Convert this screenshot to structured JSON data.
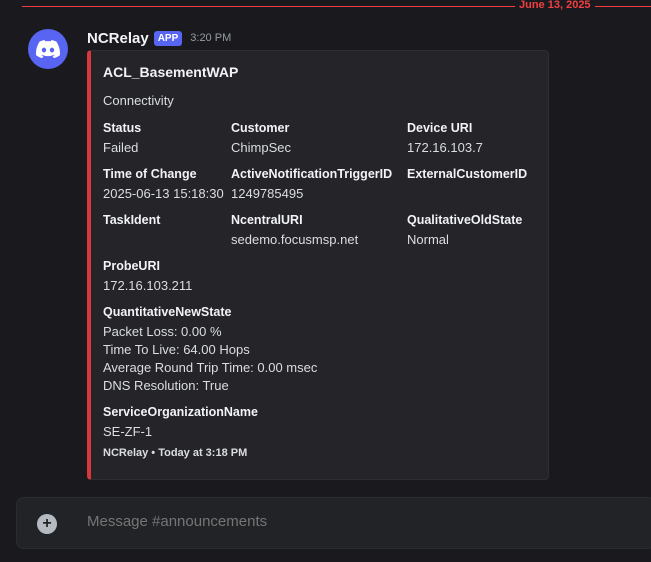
{
  "divider": {
    "date": "June 13, 2025"
  },
  "message": {
    "username": "NCRelay",
    "badge": "APP",
    "time": "3:20 PM"
  },
  "embed": {
    "title": "ACL_BasementWAP",
    "description": "Connectivity",
    "fields": {
      "status": {
        "name": "Status",
        "value": "Failed"
      },
      "customer": {
        "name": "Customer",
        "value": "ChimpSec"
      },
      "device_uri": {
        "name": "Device URI",
        "value": "172.16.103.7"
      },
      "time_of_change": {
        "name": "Time of Change",
        "value": "2025-06-13 15:18:30"
      },
      "trigger_id": {
        "name": "ActiveNotificationTriggerID",
        "value": "1249785495"
      },
      "external_customer_id": {
        "name": "ExternalCustomerID",
        "value": ""
      },
      "task_ident": {
        "name": "TaskIdent",
        "value": ""
      },
      "ncentral_uri": {
        "name": "NcentralURI",
        "value": "sedemo.focusmsp.net"
      },
      "qualitative_old_state": {
        "name": "QualitativeOldState",
        "value": "Normal"
      },
      "probe_uri": {
        "name": "ProbeURI",
        "value": "172.16.103.211"
      },
      "quantitative_new_state": {
        "name": "QuantitativeNewState",
        "lines": [
          "Packet Loss: 0.00 %",
          "Time To Live: 64.00 Hops",
          "Average Round Trip Time: 0.00 msec",
          "DNS Resolution: True"
        ]
      },
      "service_org": {
        "name": "ServiceOrganizationName",
        "value": "SE-ZF-1"
      }
    },
    "footer": "NCRelay • Today at 3:18 PM",
    "accent_color": "#da373c"
  },
  "composer": {
    "placeholder": "Message #announcements"
  }
}
